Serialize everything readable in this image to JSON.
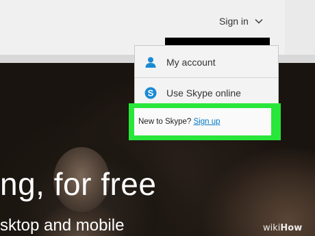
{
  "header": {
    "signin_label": "Sign in"
  },
  "dropdown": {
    "items": [
      {
        "label": "My account",
        "icon": "person-icon"
      },
      {
        "label": "Use Skype online",
        "icon": "skype-icon"
      }
    ],
    "new_prompt": "New to Skype?",
    "signup_label": "Sign up"
  },
  "hero": {
    "headline": "ng, for free",
    "subline": "sktop and mobile"
  },
  "watermark": {
    "part1": "wiki",
    "part2": "How"
  },
  "colors": {
    "accent": "#0078c8",
    "highlight": "#29e63a",
    "icon_blue": "#1a8ad4"
  }
}
